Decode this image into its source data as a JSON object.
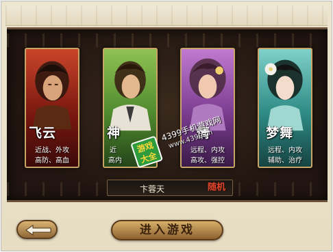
{
  "characters": [
    {
      "name": "飞云",
      "desc_line1": "近战、外攻",
      "desc_line2": "高防、高血",
      "card_color": "#7a1810"
    },
    {
      "name": "神",
      "desc_line1": "近",
      "desc_line2": "高内",
      "card_color": "#4f8a2e"
    },
    {
      "name": "情",
      "desc_line1": "远程、内攻",
      "desc_line2": "高攻、强控",
      "card_color": "#7b3c8f"
    },
    {
      "name": "梦舞",
      "desc_line1": "远程、内攻",
      "desc_line2": "辅助、治疗",
      "card_color": "#2e8a85"
    }
  ],
  "name_field": {
    "value": "卞蓉天"
  },
  "random_button": {
    "label": "随机"
  },
  "enter_button": {
    "label": "进入游戏"
  },
  "back_button": {
    "icon": "back-arrow-icon"
  },
  "watermark": {
    "badge": "游戏大全",
    "line1": "4399手机游戏网",
    "line2": "www.4399.cn"
  }
}
